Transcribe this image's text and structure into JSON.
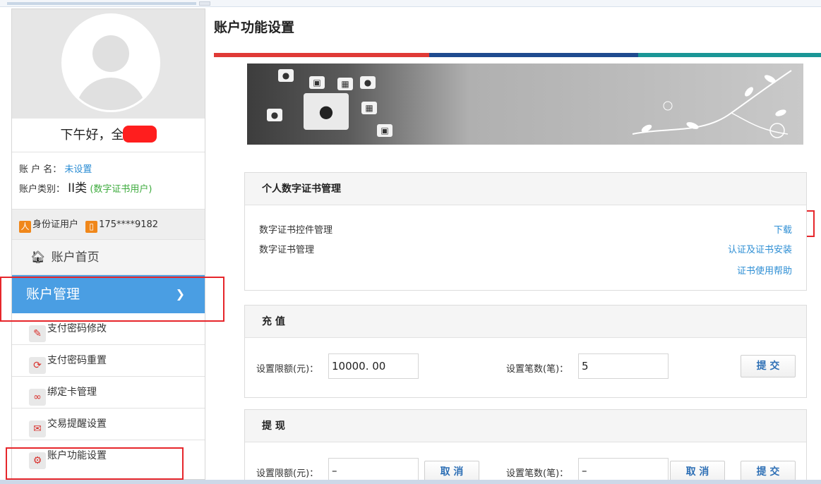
{
  "sidebar": {
    "greeting": "下午好，全",
    "account_name_label": "账 户 名：",
    "account_name_value": "未设置",
    "account_type_label": "账户类别：",
    "account_type_value": "II类",
    "account_type_note": "(数字证书用户)",
    "id_badge_icon": "人",
    "id_type": "身份证用户",
    "phone_badge_icon": "▯",
    "phone": "175****9182",
    "home_label": "账户首页",
    "account_mgmt_label": "账户管理",
    "items": [
      {
        "label": "支付密码修改",
        "icon": "✎"
      },
      {
        "label": "支付密码重置",
        "icon": "⟳"
      },
      {
        "label": "绑定卡管理",
        "icon": "∞"
      },
      {
        "label": "交易提醒设置",
        "icon": "✉"
      },
      {
        "label": "账户功能设置",
        "icon": "⚙"
      }
    ]
  },
  "main": {
    "title": "账户功能设置",
    "cert_panel": {
      "title": "个人数字证书管理",
      "row1": "数字证书控件管理",
      "row2": "数字证书管理",
      "link_download": "下载",
      "link_install": "认证及证书安装",
      "link_help": "证书使用帮助"
    },
    "recharge_panel": {
      "title": "充 值",
      "limit_label": "设置限额(元)：",
      "limit_value": "10000. 00",
      "count_label": "设置笔数(笔)：",
      "count_value": "5",
      "submit": "提 交"
    },
    "withdraw_panel": {
      "title": "提 现",
      "limit_label": "设置限额(元)：",
      "limit_value": "–",
      "cancel1": "取 消",
      "count_label": "设置笔数(笔)：",
      "count_value": "–",
      "cancel2": "取 消",
      "submit": "提 交"
    }
  },
  "colors": {
    "accent_blue": "#4a9ee3",
    "link_blue": "#2d8ed4",
    "highlight_red": "#e6262b",
    "stripe_red": "#e03a36",
    "stripe_navy": "#1f4b8f",
    "stripe_teal": "#1a9696"
  }
}
